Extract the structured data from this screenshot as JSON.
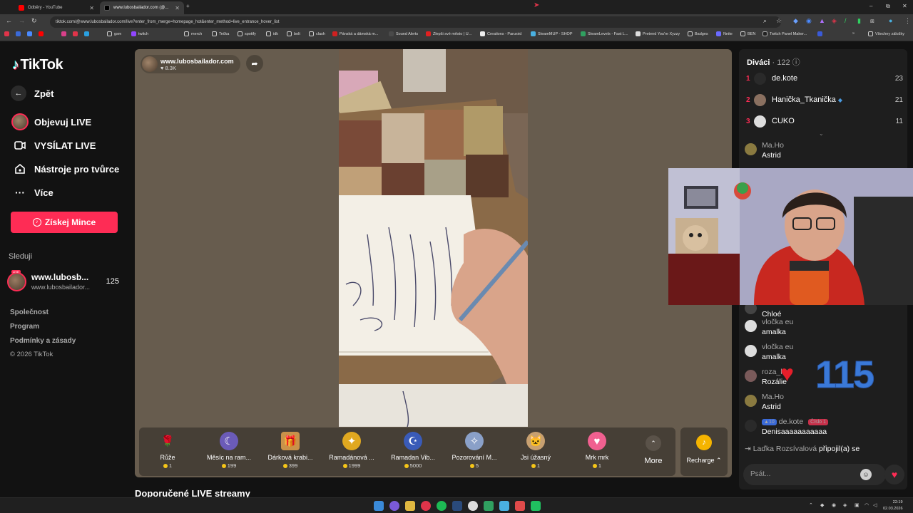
{
  "browser": {
    "tabs": [
      {
        "title": "Odběry - YouTube",
        "active": false,
        "color": "#ff0000"
      },
      {
        "title": "www.lubosbailador.com (@...",
        "active": true,
        "color": "#111111"
      }
    ],
    "new_tab": "+",
    "window_controls": {
      "minimize": "–",
      "maximize": "⧉",
      "close": "✕"
    },
    "url": "tiktok.com/@www.lubosbailador.com/live?enter_from_merge=homepage_hot&enter_method=live_entrance_hover_list",
    "bookmarks": [
      "",
      "",
      "",
      "",
      "",
      "",
      "",
      "gsm",
      "",
      "twitch",
      "",
      "merch",
      "Tečka",
      "spotify",
      "idk",
      "bolt",
      "clash",
      "Pánská a dámská m...",
      "Sound Alerts",
      "Zlepši své město | U...",
      "Creations - Panzoid",
      "SteamMUP - SHOP",
      "SteamLevels - Fast L...",
      "Pretend You're Xyzzy",
      "Badges",
      "Nnite",
      "BEN",
      "Twitch Panel Maker...",
      "",
      "Všechny záložky"
    ]
  },
  "sidebar": {
    "logo": "TikTok",
    "back_label": "Zpět",
    "menu": [
      {
        "label": "Objevuj LIVE",
        "icon": "avatar-icon"
      },
      {
        "label": "VYSÍLAT LIVE",
        "icon": "camera-icon"
      },
      {
        "label": "Nástroje pro tvůrce",
        "icon": "home-icon"
      },
      {
        "label": "Více",
        "icon": "more-icon"
      }
    ],
    "coins_button": "Získej Mince",
    "following_title": "Sleduji",
    "followed": {
      "name": "www.lubosb...",
      "handle": "www.lubosbailador...",
      "count": "125",
      "live_badge": "LIVE"
    },
    "footer": [
      "Společnost",
      "Program",
      "Podmínky a zásady",
      "© 2026 TikTok"
    ]
  },
  "stream": {
    "host_name": "www.lubosbailador.com",
    "likes": "8.3K",
    "gifts": [
      {
        "name": "Růže",
        "price": "1",
        "icon": "rose-icon",
        "color": "#e0344a"
      },
      {
        "name": "Měsíc na ram...",
        "price": "199",
        "icon": "moon-icon",
        "color": "#6b5bb8"
      },
      {
        "name": "Dárková krabi...",
        "price": "399",
        "icon": "gift-box-icon",
        "color": "#c9924a"
      },
      {
        "name": "Ramadánová ...",
        "price": "1999",
        "icon": "lantern-icon",
        "color": "#e0a820"
      },
      {
        "name": "Ramadan Vib...",
        "price": "5000",
        "icon": "mosque-icon",
        "color": "#3a5bb8"
      },
      {
        "name": "Pozorování M...",
        "price": "5",
        "icon": "telescope-icon",
        "color": "#8aa0c8"
      },
      {
        "name": "Jsi úžasný",
        "price": "1",
        "icon": "cat-icon",
        "color": "#c8a070"
      },
      {
        "name": "Mrk mrk",
        "price": "1",
        "icon": "heart-face-icon",
        "color": "#f06090"
      }
    ],
    "more_label": "More",
    "recharge_label": "Recharge",
    "recommended_title": "Doporučené LIVE streamy"
  },
  "chat": {
    "viewers_label": "Diváci",
    "viewers_count": "122",
    "top_viewers": [
      {
        "rank": "1",
        "name": "de.kote",
        "score": "23",
        "color": "#2a2a2a"
      },
      {
        "rank": "2",
        "name": "Hanička_Tkanička",
        "score": "21",
        "color": "#8a7060"
      },
      {
        "rank": "3",
        "name": "CUKO",
        "score": "11",
        "color": "#dddddd"
      }
    ],
    "messages": [
      {
        "user": "Ma.Ho",
        "text": "Astrid",
        "color": "#8a7a40"
      },
      {
        "user": "",
        "text": "Chloé",
        "color": "#444444"
      },
      {
        "user": "vločka eu",
        "text": "amalka",
        "color": "#dddddd"
      },
      {
        "user": "vločka eu",
        "text": "amalka",
        "color": "#dddddd"
      },
      {
        "user": "roza_lka",
        "text": "Rozálie",
        "color": "#7a5a5a"
      },
      {
        "user": "Ma.Ho",
        "text": "Astrid",
        "color": "#8a7a40"
      },
      {
        "user": "de.kote",
        "text": "Denisaaaaaaaaaaa",
        "color": "#2a2a2a",
        "level": "10",
        "badge": "Číslo 1"
      }
    ],
    "join_user": "Laďka Rozsívalová",
    "join_text": "připojil(a) se",
    "input_placeholder": "Psát..."
  },
  "overlay": {
    "counter": "115"
  },
  "taskbar": {
    "time": "22:19",
    "date": "02.03.2026"
  }
}
